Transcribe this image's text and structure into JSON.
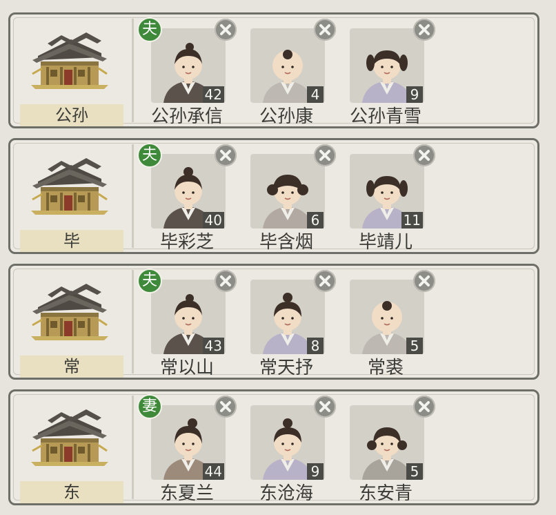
{
  "families": [
    {
      "surname": "公孙",
      "members": [
        {
          "name": "公孙承信",
          "age": "42",
          "role": "夫",
          "avatar": "adult-male-topknot"
        },
        {
          "name": "公孙康",
          "age": "4",
          "role": "",
          "avatar": "infant-tuft"
        },
        {
          "name": "公孙青雪",
          "age": "9",
          "role": "",
          "avatar": "girl-pigtails"
        }
      ]
    },
    {
      "surname": "毕",
      "members": [
        {
          "name": "毕彩芝",
          "age": "40",
          "role": "夫",
          "avatar": "adult-male-bun"
        },
        {
          "name": "毕含烟",
          "age": "6",
          "role": "",
          "avatar": "girl-bangs-buns"
        },
        {
          "name": "毕靖儿",
          "age": "11",
          "role": "",
          "avatar": "girl-pigtails"
        }
      ]
    },
    {
      "surname": "常",
      "members": [
        {
          "name": "常以山",
          "age": "43",
          "role": "夫",
          "avatar": "adult-male-topknot"
        },
        {
          "name": "常天抒",
          "age": "8",
          "role": "",
          "avatar": "child-topknot"
        },
        {
          "name": "常裘",
          "age": "5",
          "role": "",
          "avatar": "infant-tuft"
        }
      ]
    },
    {
      "surname": "东",
      "members": [
        {
          "name": "东夏兰",
          "age": "44",
          "role": "妻",
          "avatar": "adult-female-bun"
        },
        {
          "name": "东沧海",
          "age": "9",
          "role": "",
          "avatar": "child-topknot"
        },
        {
          "name": "东安青",
          "age": "5",
          "role": "",
          "avatar": "girl-side-buns"
        }
      ]
    }
  ],
  "colors": {
    "panel_border": "#6e6e68",
    "plate": "#e9dfc1",
    "role_badge": "#3f8a3a",
    "remove_button": "#8d8d87",
    "age_tag": "#4a4a46"
  },
  "icons": {
    "remove": "close-x-icon",
    "house": "wooden-house-icon"
  }
}
